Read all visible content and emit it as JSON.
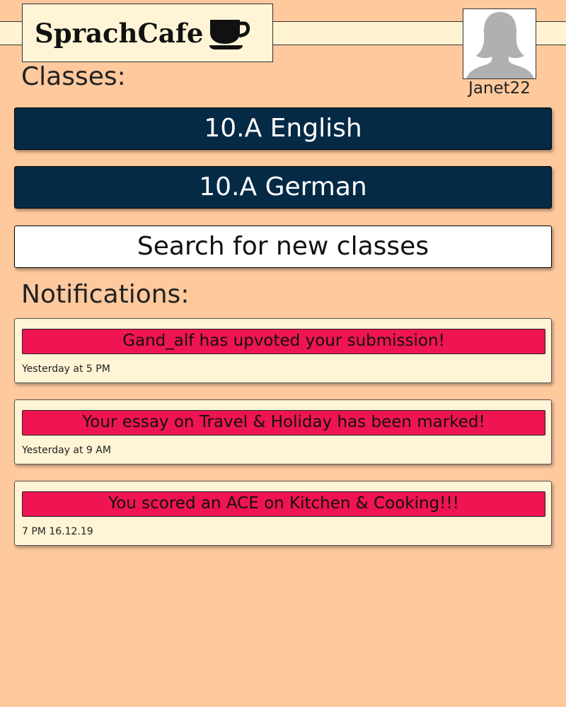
{
  "app": {
    "name": "SprachCafe",
    "logo_icon": "coffee-cup-icon"
  },
  "user": {
    "username": "Janet22",
    "avatar_icon": "user-silhouette-icon"
  },
  "classes": {
    "title": "Classes:",
    "items": [
      {
        "label": "10.A English"
      },
      {
        "label": "10.A German"
      }
    ],
    "search_label": "Search for new classes"
  },
  "notifications": {
    "title": "Notifications:",
    "items": [
      {
        "message": "Gand_alf has upvoted your submission!",
        "time": "Yesterday at 5 PM"
      },
      {
        "message": "Your essay on Travel & Holiday has been marked!",
        "time": "Yesterday at 9 AM"
      },
      {
        "message": "You scored an ACE on Kitchen & Cooking!!!",
        "time": "7 PM 16.12.19"
      }
    ]
  },
  "colors": {
    "background": "#fdc99d",
    "class_button": "#052a45",
    "notification_highlight": "#ef1452",
    "panel": "#fff4d5"
  }
}
